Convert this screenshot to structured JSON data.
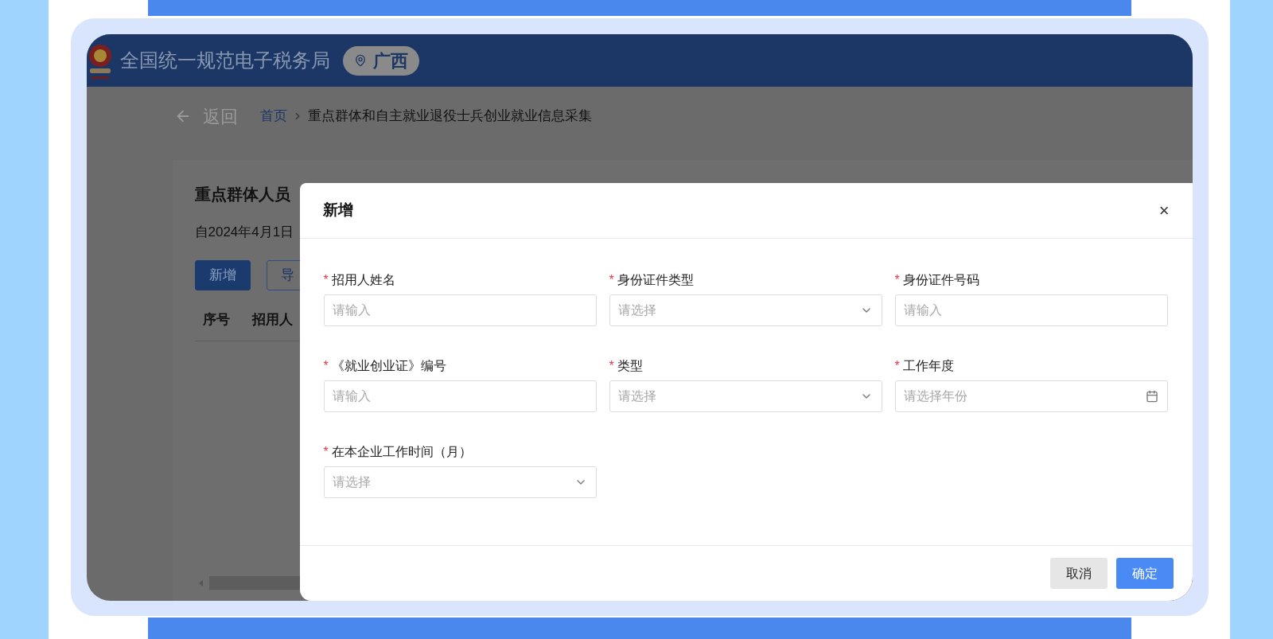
{
  "header": {
    "title": "全国统一规范电子税务局",
    "region": "广西"
  },
  "breadcrumb": {
    "back": "返回",
    "items": [
      "首页",
      "重点群体和自主就业退役士兵创业就业信息采集"
    ]
  },
  "page": {
    "title": "重点群体人员",
    "notice": "自2024年4月1日",
    "buttons": [
      {
        "label": "新增",
        "kind": "primary"
      },
      {
        "label": "导",
        "kind": "outline"
      }
    ],
    "columns": [
      "序号",
      "招用人"
    ]
  },
  "dialog": {
    "title": "新增",
    "close": "×",
    "fields": [
      {
        "label": "招用人姓名",
        "marker": "*",
        "kind": "text",
        "placeholder": "请输入"
      },
      {
        "label": "身份证件类型",
        "marker": "*",
        "kind": "select",
        "placeholder": "请选择"
      },
      {
        "label": "身份证件号码",
        "marker": "*",
        "kind": "text",
        "placeholder": "请输入"
      },
      {
        "label": "《就业创业证》编号",
        "marker": "*",
        "kind": "text",
        "placeholder": "请输入"
      },
      {
        "label": "类型",
        "marker": "*",
        "kind": "select",
        "placeholder": "请选择"
      },
      {
        "label": "工作年度",
        "marker": "*",
        "kind": "date",
        "placeholder": "请选择年份"
      },
      {
        "label": "在本企业工作时间（月）",
        "marker": "*",
        "kind": "select",
        "placeholder": "请选择"
      }
    ],
    "buttons": [
      {
        "label": "取消",
        "kind": "secondary"
      },
      {
        "label": "确定",
        "kind": "primary"
      }
    ]
  }
}
